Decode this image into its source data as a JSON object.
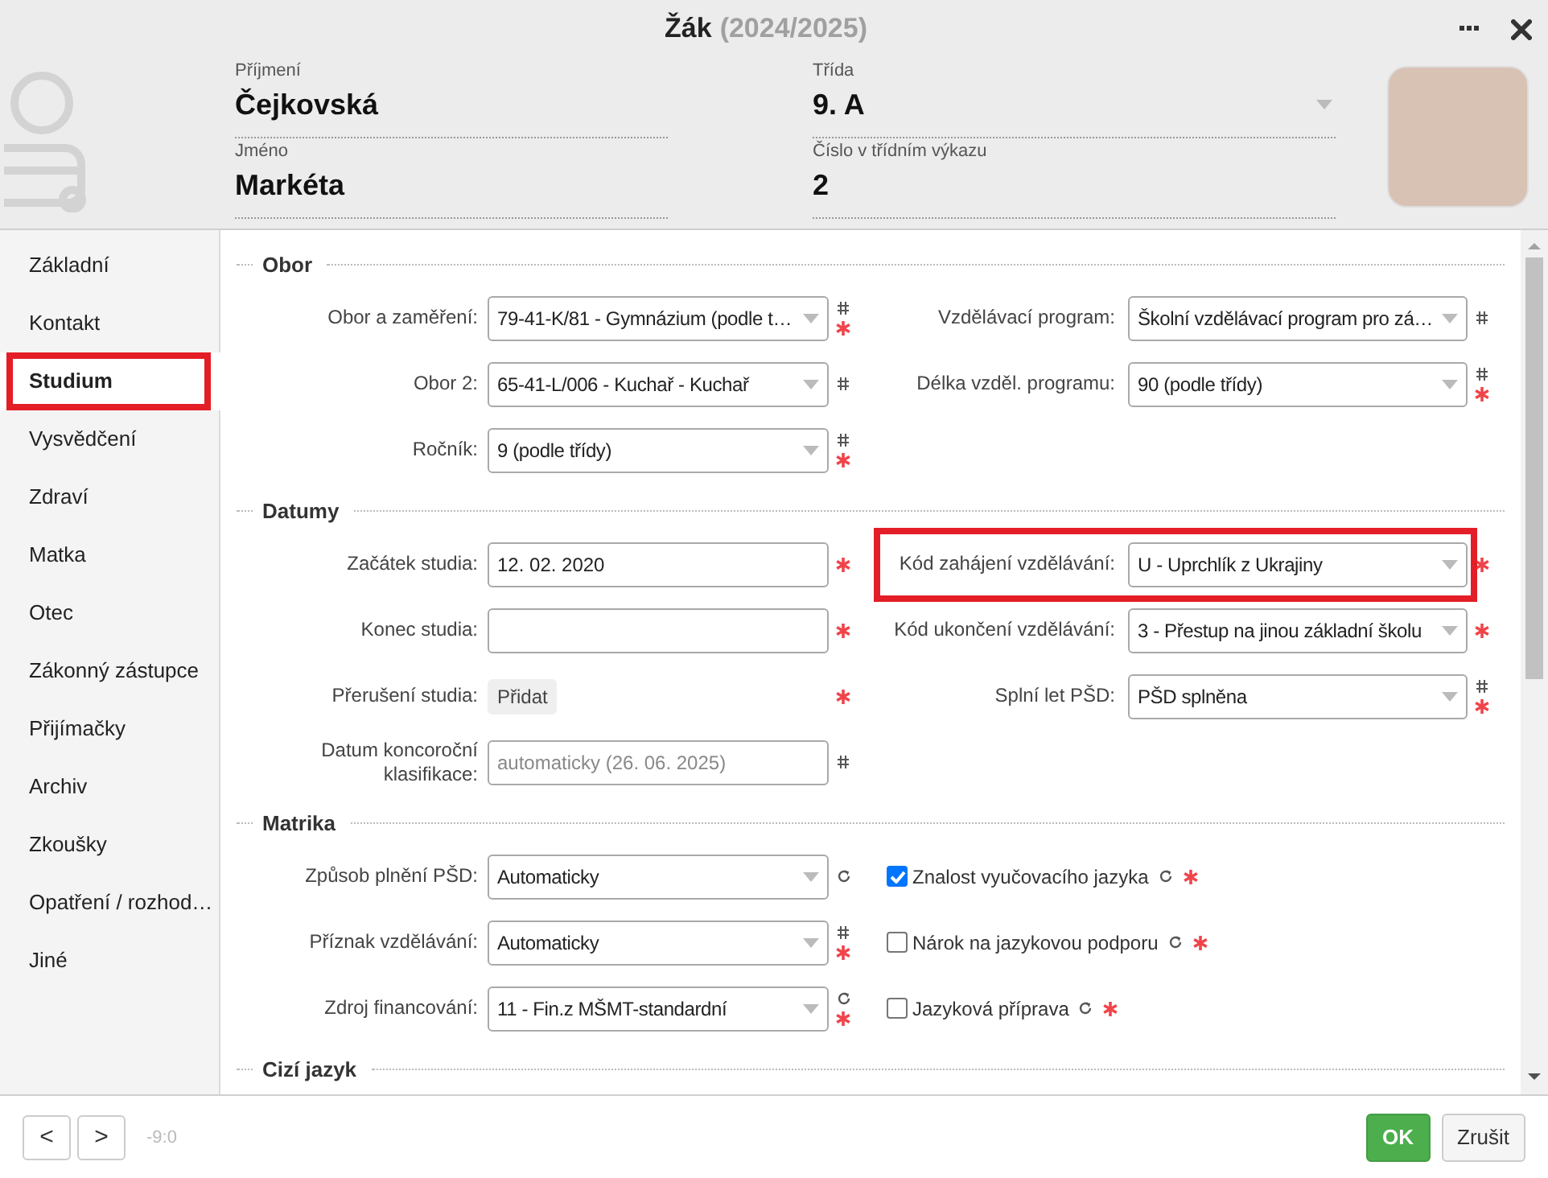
{
  "window": {
    "title": "Žák",
    "subtitle": "(2024/2025)"
  },
  "header": {
    "columns": [
      [
        {
          "label": "Příjmení",
          "value": "Čejkovská",
          "dropdown": false
        },
        {
          "label": "Jméno",
          "value": "Markéta",
          "dropdown": false
        }
      ],
      [
        {
          "label": "Třída",
          "value": "9. A",
          "dropdown": true
        },
        {
          "label": "Číslo v třídním výkazu",
          "value": "2",
          "dropdown": false
        }
      ]
    ]
  },
  "sidebar": {
    "items": [
      {
        "label": "Základní",
        "selected": false,
        "highlighted": false
      },
      {
        "label": "Kontakt",
        "selected": false,
        "highlighted": false
      },
      {
        "label": "Studium",
        "selected": true,
        "highlighted": true
      },
      {
        "label": "Vysvědčení",
        "selected": false,
        "highlighted": false
      },
      {
        "label": "Zdraví",
        "selected": false,
        "highlighted": false
      },
      {
        "label": "Matka",
        "selected": false,
        "highlighted": false
      },
      {
        "label": "Otec",
        "selected": false,
        "highlighted": false
      },
      {
        "label": "Zákonný zástupce",
        "selected": false,
        "highlighted": false
      },
      {
        "label": "Přijímačky",
        "selected": false,
        "highlighted": false
      },
      {
        "label": "Archiv",
        "selected": false,
        "highlighted": false
      },
      {
        "label": "Zkoušky",
        "selected": false,
        "highlighted": false
      },
      {
        "label": "Opatření / rozhod…",
        "selected": false,
        "highlighted": false
      },
      {
        "label": "Jiné",
        "selected": false,
        "highlighted": false
      }
    ]
  },
  "sections": [
    {
      "title": "Obor",
      "rows": [
        {
          "left": {
            "label": "Obor a zaměření:",
            "kind": "select",
            "value": "79-41-K/81 - Gymnázium (podle t…",
            "hash": true,
            "required": true,
            "refresh": false,
            "highlighted": false
          },
          "right": {
            "label": "Vzdělávací program:",
            "kind": "select",
            "value": "Školní vzdělávací program pro zá…",
            "hash": true,
            "required": false,
            "refresh": false,
            "highlighted": false
          }
        },
        {
          "left": {
            "label": "Obor 2:",
            "kind": "select",
            "value": "65-41-L/006 - Kuchař - Kuchař",
            "hash": true,
            "required": false,
            "refresh": false,
            "highlighted": false
          },
          "right": {
            "label": "Délka vzděl. programu:",
            "kind": "select",
            "value": "90 (podle třídy)",
            "hash": true,
            "required": true,
            "refresh": false,
            "highlighted": false
          }
        },
        {
          "left": {
            "label": "Ročník:",
            "kind": "select",
            "value": "9 (podle třídy)",
            "hash": true,
            "required": true,
            "refresh": false,
            "highlighted": false
          }
        }
      ]
    },
    {
      "title": "Datumy",
      "rows": [
        {
          "left": {
            "label": "Začátek studia:",
            "kind": "date",
            "value": "12. 02. 2020",
            "hash": false,
            "required": true,
            "refresh": false,
            "highlighted": false
          },
          "right": {
            "label": "Kód zahájení vzdělávání:",
            "kind": "select",
            "value": "U - Uprchlík z Ukrajiny",
            "hash": false,
            "required": true,
            "refresh": false,
            "highlighted": true
          }
        },
        {
          "left": {
            "label": "Konec studia:",
            "kind": "date",
            "hash": false,
            "required": true,
            "refresh": false,
            "highlighted": false
          },
          "right": {
            "label": "Kód ukončení vzdělávání:",
            "kind": "select",
            "value": "3 - Přestup na jinou základní školu",
            "hash": false,
            "required": true,
            "refresh": false,
            "highlighted": false
          }
        },
        {
          "left": {
            "label": "Přerušení studia:",
            "kind": "button",
            "value": "Přidat",
            "hash": false,
            "required": true,
            "refresh": false,
            "highlighted": false
          },
          "right": {
            "label": "Splní let PŠD:",
            "kind": "select",
            "value": "PŠD splněna",
            "hash": true,
            "required": true,
            "refresh": false,
            "highlighted": false
          }
        },
        {
          "left": {
            "label": "Datum koncoroční klasifikace:",
            "kind": "text",
            "placeholder": "automaticky (26. 06. 2025)",
            "hash": true,
            "required": false,
            "refresh": false,
            "highlighted": false
          }
        }
      ]
    },
    {
      "title": "Matrika",
      "rows": [
        {
          "left": {
            "label": "Způsob plnění PŠD:",
            "kind": "select",
            "value": "Automaticky",
            "hash": false,
            "required": false,
            "refresh": true,
            "highlighted": false
          },
          "right": {
            "label": "Znalost vyučovacího jazyka",
            "kind": "checkbox",
            "checked": true,
            "hash": false,
            "required": true,
            "refresh": true,
            "highlighted": false
          }
        },
        {
          "left": {
            "label": "Příznak vzdělávání:",
            "kind": "select",
            "value": "Automaticky",
            "hash": true,
            "required": true,
            "refresh": false,
            "highlighted": false
          },
          "right": {
            "label": "Nárok na jazykovou podporu",
            "kind": "checkbox",
            "checked": false,
            "hash": false,
            "required": true,
            "refresh": true,
            "highlighted": false
          }
        },
        {
          "left": {
            "label": "Zdroj financování:",
            "kind": "select",
            "value": "11 - Fin.z MŠMT-standardní",
            "hash": false,
            "required": true,
            "refresh": true,
            "highlighted": false
          },
          "right": {
            "label": "Jazyková příprava",
            "kind": "checkbox",
            "checked": false,
            "hash": false,
            "required": true,
            "refresh": true,
            "highlighted": false
          }
        }
      ]
    },
    {
      "title": "Cizí jazyk"
    }
  ],
  "footer": {
    "nav_buttons": [
      "<",
      ">"
    ],
    "position": "-9:0",
    "buttons": [
      {
        "label": "OK",
        "kind": "primary"
      },
      {
        "label": "Zrušit",
        "kind": "secondary"
      }
    ]
  }
}
